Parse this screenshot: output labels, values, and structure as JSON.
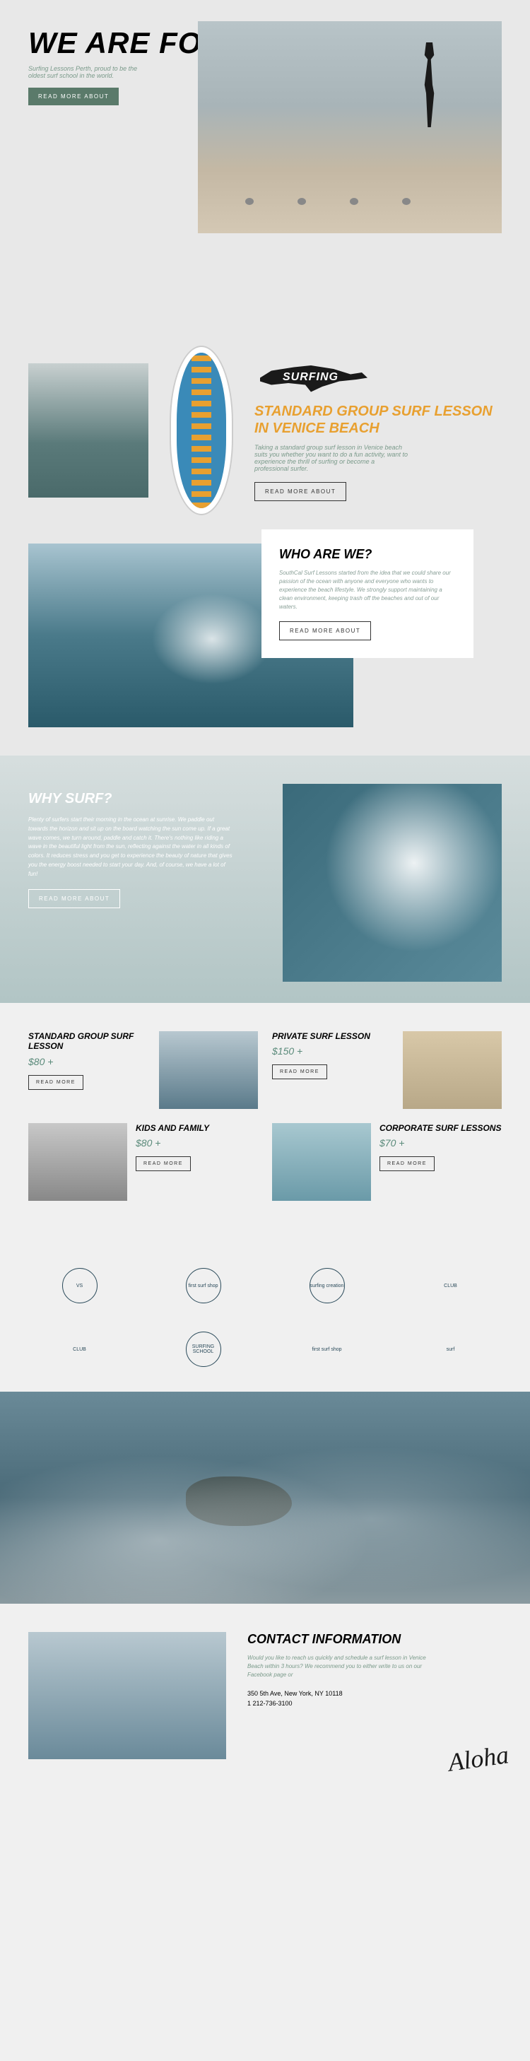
{
  "hero": {
    "title": "WE ARE FOURTHE",
    "subtitle": "Surfing Lessons Perth, proud to be the oldest surf school in the world.",
    "button": "READ MORE ABOUT"
  },
  "lesson": {
    "logo_text": "SURFING",
    "title": "STANDARD GROUP SURF LESSON IN VENICE BEACH",
    "desc": "Taking a standard group surf lesson in Venice beach suits you whether you want to do a fun activity, want to experience the thrill of surfing or become a professional surfer.",
    "button": "READ MORE ABOUT"
  },
  "who": {
    "title": "WHO ARE WE?",
    "desc": "SouthCal Surf Lessons started from the idea that we could share our passion of the ocean with anyone and everyone who wants to experience the beach lifestyle. We strongly support maintaining a clean environment, keeping trash off the beaches and out of our waters.",
    "button": "READ MORE ABOUT"
  },
  "why": {
    "title": "WHY SURF?",
    "desc": "Plenty of surfers start their morning in the ocean at sunrise. We paddle out towards the horizon and sit up on the board watching the sun come up. If a great wave comes, we turn around, paddle and catch it. There's nothing like riding a wave in the beautiful light from the sun, reflecting against the water in all kinds of colors. It reduces stress and you get to experience the beauty of nature that gives you the energy boost needed to start your day. And, of course, we have a lot of fun!",
    "button": "READ MORE ABOUT"
  },
  "lessons": [
    {
      "title": "STANDARD GROUP SURF LESSON",
      "price": "$80 +",
      "button": "READ MORE"
    },
    {
      "title": "PRIVATE SURF LESSON",
      "price": "$150 +",
      "button": "READ MORE"
    },
    {
      "title": "KIDS AND FAMILY",
      "price": "$80 +",
      "button": "READ MORE"
    },
    {
      "title": "CORPORATE SURF LESSONS",
      "price": "$70 +",
      "button": "READ MORE"
    }
  ],
  "partners": [
    "VS",
    "first surf shop",
    "surfing creation",
    "CLUB",
    "CLUB",
    "SURFING SCHOOL",
    "first surf shop",
    "surf"
  ],
  "contact": {
    "title": "CONTACT INFORMATION",
    "desc": "Would you like to reach us quickly and schedule a surf lesson in Venice Beach within 3 hours? We recommend you to either write to us on our Facebook page or",
    "address": "350 5th Ave, New York, NY 10118",
    "phone": "1 212-736-3100",
    "aloha": "Aloha"
  }
}
